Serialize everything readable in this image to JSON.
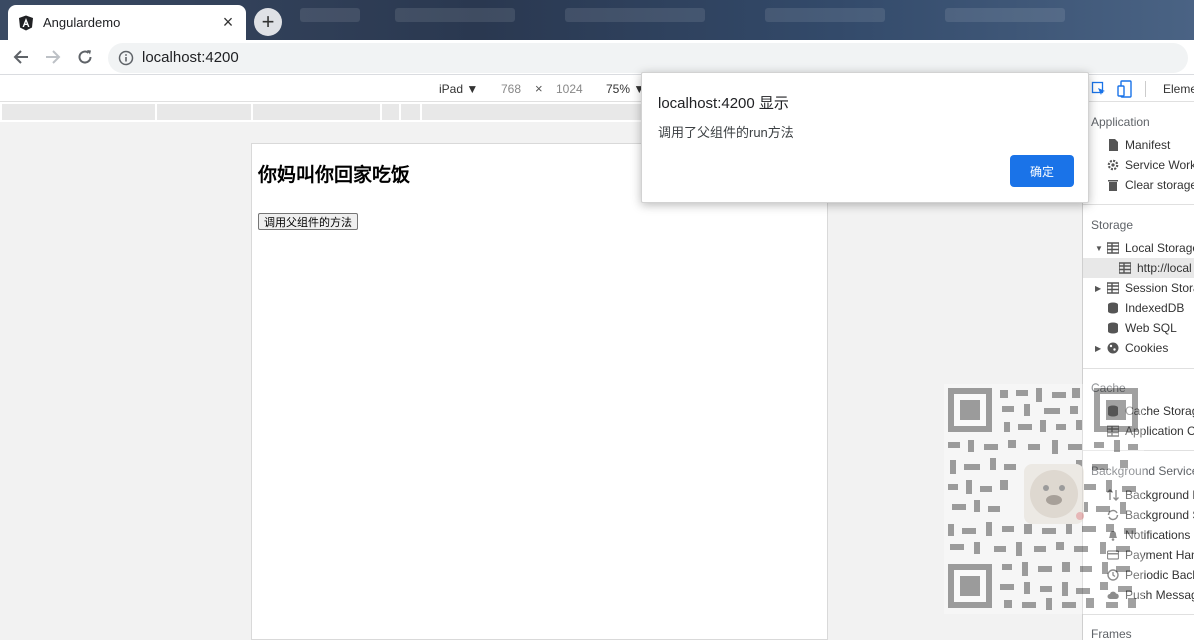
{
  "browser": {
    "tab_title": "Angulardemo",
    "url": "localhost:4200"
  },
  "device_toolbar": {
    "device": "iPad ▼",
    "width": "768",
    "separator": "×",
    "height": "1024",
    "zoom": "75% ▼"
  },
  "page": {
    "heading": "你妈叫你回家吃饭",
    "button_label": "调用父组件的方法"
  },
  "dialog": {
    "title": "localhost:4200 显示",
    "message": "调用了父组件的run方法",
    "ok_label": "确定"
  },
  "devtools": {
    "top_tab": "Eleme",
    "sections": {
      "application": "Application",
      "storage": "Storage",
      "cache": "Cache",
      "background": "Background Service",
      "frames": "Frames"
    },
    "application_items": [
      "Manifest",
      "Service Work",
      "Clear storage"
    ],
    "storage_items": [
      "Local Storage",
      "http://local",
      "Session Stora",
      "IndexedDB",
      "Web SQL",
      "Cookies"
    ],
    "cache_items": [
      "Cache Storag",
      "Application C"
    ],
    "background_items": [
      "Background F",
      "Background S",
      "Notifications",
      "Payment Han",
      "Periodic Back",
      "Push Messag"
    ]
  },
  "colors": {
    "accent": "#1a73e8",
    "tab_strip": "#2a3850"
  }
}
